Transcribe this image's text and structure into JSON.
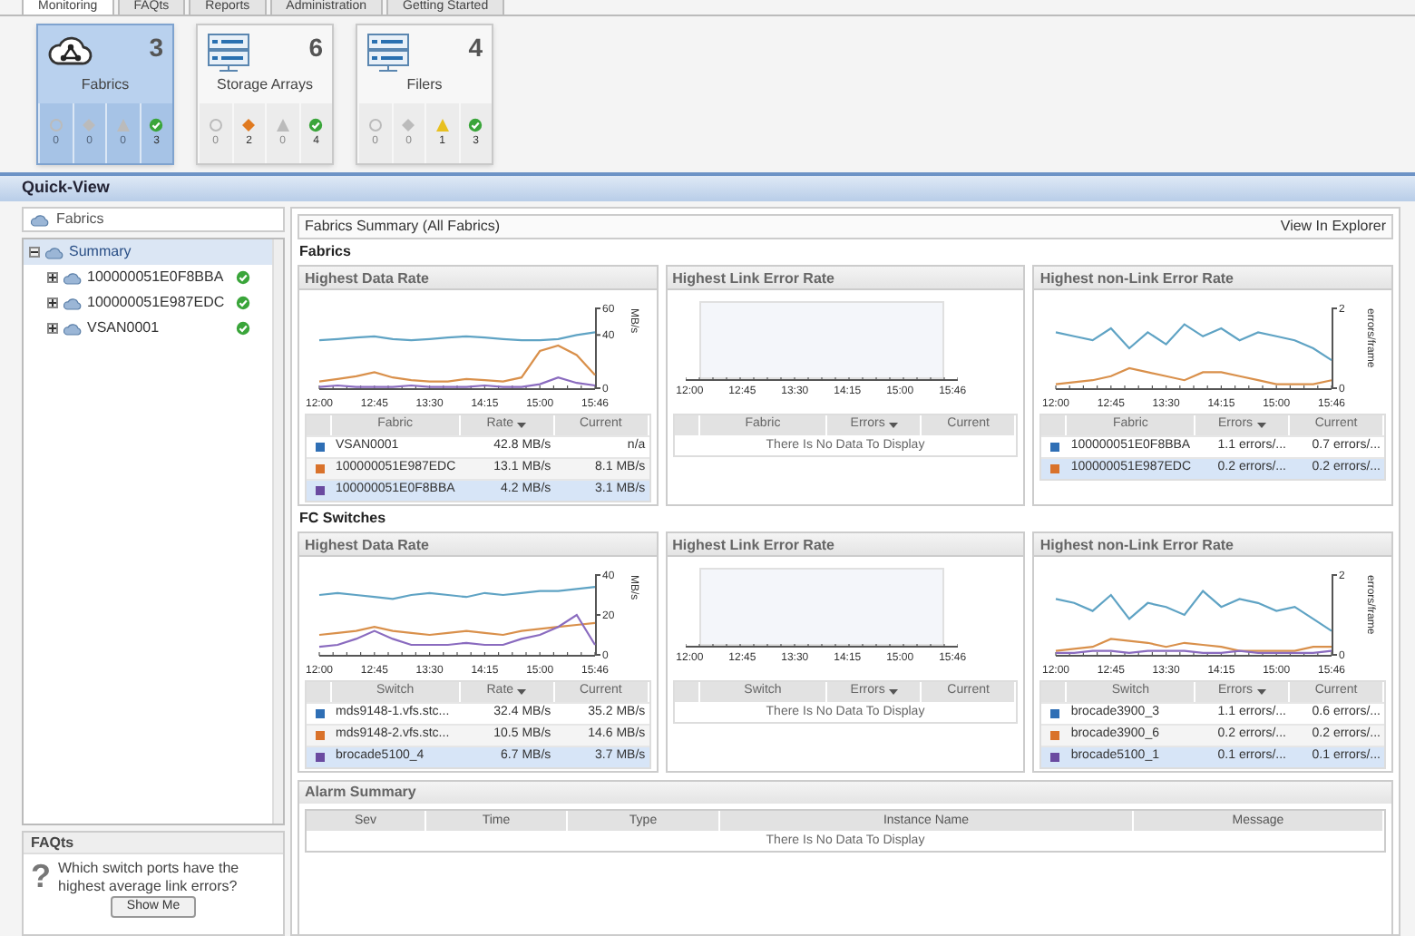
{
  "tabs": [
    {
      "label": "Monitoring",
      "selected": true
    },
    {
      "label": "FAQts",
      "selected": false
    },
    {
      "label": "Reports",
      "selected": false
    },
    {
      "label": "Administration",
      "selected": false
    },
    {
      "label": "Getting Started",
      "selected": false
    }
  ],
  "tiles": [
    {
      "label": "Fabrics",
      "count": "3",
      "selected": true,
      "statuses": [
        {
          "kind": "critical",
          "count": "0",
          "active": false
        },
        {
          "kind": "major",
          "count": "0",
          "active": false
        },
        {
          "kind": "warning",
          "count": "0",
          "active": false
        },
        {
          "kind": "ok",
          "count": "3",
          "active": true
        }
      ]
    },
    {
      "label": "Storage Arrays",
      "count": "6",
      "selected": false,
      "statuses": [
        {
          "kind": "critical",
          "count": "0",
          "active": false
        },
        {
          "kind": "major",
          "count": "2",
          "active": true
        },
        {
          "kind": "warning",
          "count": "0",
          "active": false
        },
        {
          "kind": "ok",
          "count": "4",
          "active": true
        }
      ]
    },
    {
      "label": "Filers",
      "count": "4",
      "selected": false,
      "statuses": [
        {
          "kind": "critical",
          "count": "0",
          "active": false
        },
        {
          "kind": "major",
          "count": "0",
          "active": false
        },
        {
          "kind": "warning",
          "count": "1",
          "active": true
        },
        {
          "kind": "ok",
          "count": "3",
          "active": true
        }
      ]
    }
  ],
  "quick_view": {
    "title": "Quick-View",
    "selector": "Fabrics",
    "tree": [
      {
        "label": "Summary",
        "expanded": true,
        "selected": true,
        "children": [
          {
            "label": "100000051E0F8BBA",
            "expanded": false,
            "selected": false,
            "healthy": true
          },
          {
            "label": "100000051E987EDC",
            "expanded": false,
            "selected": false,
            "healthy": true
          },
          {
            "label": "VSAN0001",
            "expanded": false,
            "selected": false,
            "healthy": true
          }
        ]
      }
    ],
    "faq": {
      "title": "FAQts",
      "mark": "?",
      "question": "Which switch ports have the highest average link errors?",
      "button": "Show Me"
    }
  },
  "summary": {
    "title": "Fabrics Summary (All Fabrics)",
    "link": "View In Explorer",
    "sections": [
      {
        "title": "Fabrics",
        "panels": [
          {
            "title": "Highest Data Rate",
            "kind": "data",
            "chart_data": {
              "type": "line",
              "categories": [
                "12:00",
                null,
                null,
                "12:45",
                null,
                null,
                "13:30",
                null,
                null,
                "14:15",
                null,
                null,
                "15:00",
                null,
                null,
                "15:46"
              ],
              "yticks": [
                0,
                40,
                60
              ],
              "ylim": [
                0,
                60
              ],
              "ylabel": "MB/s",
              "series": [
                {
                  "color": "#5fa3c4",
                  "values": [
                    36,
                    37,
                    38,
                    39,
                    37,
                    36,
                    37,
                    38,
                    39,
                    38,
                    37,
                    36,
                    36,
                    37,
                    40,
                    42
                  ]
                },
                {
                  "color": "#d9904b",
                  "values": [
                    5,
                    7,
                    9,
                    12,
                    8,
                    6,
                    5,
                    5,
                    7,
                    6,
                    5,
                    8,
                    28,
                    32,
                    25,
                    10
                  ]
                },
                {
                  "color": "#8a6bbf",
                  "values": [
                    1,
                    2,
                    1,
                    1,
                    1,
                    2,
                    1,
                    1,
                    1,
                    2,
                    1,
                    1,
                    3,
                    8,
                    4,
                    2
                  ]
                }
              ]
            },
            "columns": [
              {
                "label": "Fabric",
                "sorted": false
              },
              {
                "label": "Rate",
                "sorted": true
              },
              {
                "label": "Current",
                "sorted": false
              }
            ],
            "rows": [
              {
                "color": "#2f6fb5",
                "name": "VSAN0001",
                "rate": "42.8 MB/s",
                "current": "n/a",
                "selected": false
              },
              {
                "color": "#d9722b",
                "name": "100000051E987EDC",
                "rate": "13.1 MB/s",
                "current": "8.1 MB/s",
                "selected": false
              },
              {
                "color": "#6a4aa0",
                "name": "100000051E0F8BBA",
                "rate": "4.2 MB/s",
                "current": "3.1 MB/s",
                "selected": true
              }
            ]
          },
          {
            "title": "Highest Link Error Rate",
            "kind": "empty",
            "x_ticks": [
              "12:00",
              "12:45",
              "13:30",
              "14:15",
              "15:00",
              "15:46"
            ],
            "columns": [
              {
                "label": "Fabric",
                "sorted": false
              },
              {
                "label": "Errors",
                "sorted": true
              },
              {
                "label": "Current",
                "sorted": false
              }
            ],
            "empty_text": "There Is No Data To Display"
          },
          {
            "title": "Highest non-Link Error Rate",
            "kind": "data",
            "chart_data": {
              "type": "line",
              "categories": [
                "12:00",
                null,
                null,
                "12:45",
                null,
                null,
                "13:30",
                null,
                null,
                "14:15",
                null,
                null,
                "15:00",
                null,
                null,
                "15:46"
              ],
              "yticks": [
                0,
                2
              ],
              "ylim": [
                0,
                2
              ],
              "ylabel": "errors/frame",
              "series": [
                {
                  "color": "#5fa3c4",
                  "values": [
                    1.4,
                    1.3,
                    1.2,
                    1.5,
                    1.0,
                    1.4,
                    1.1,
                    1.6,
                    1.3,
                    1.5,
                    1.2,
                    1.4,
                    1.3,
                    1.2,
                    1.0,
                    0.7
                  ]
                },
                {
                  "color": "#d9904b",
                  "values": [
                    0.1,
                    0.15,
                    0.2,
                    0.3,
                    0.5,
                    0.4,
                    0.3,
                    0.2,
                    0.4,
                    0.4,
                    0.3,
                    0.2,
                    0.1,
                    0.1,
                    0.1,
                    0.2
                  ]
                }
              ]
            },
            "columns": [
              {
                "label": "Fabric",
                "sorted": false
              },
              {
                "label": "Errors",
                "sorted": true
              },
              {
                "label": "Current",
                "sorted": false
              }
            ],
            "rows": [
              {
                "color": "#2f6fb5",
                "name": "100000051E0F8BBA",
                "rate": "1.1 errors/...",
                "current": "0.7 errors/...",
                "selected": false
              },
              {
                "color": "#d9722b",
                "name": "100000051E987EDC",
                "rate": "0.2 errors/...",
                "current": "0.2 errors/...",
                "selected": true
              }
            ]
          }
        ]
      },
      {
        "title": "FC Switches",
        "panels": [
          {
            "title": "Highest Data Rate",
            "kind": "data",
            "chart_data": {
              "type": "line",
              "categories": [
                "12:00",
                null,
                null,
                "12:45",
                null,
                null,
                "13:30",
                null,
                null,
                "14:15",
                null,
                null,
                "15:00",
                null,
                null,
                "15:46"
              ],
              "yticks": [
                0,
                20,
                40
              ],
              "ylim": [
                0,
                40
              ],
              "ylabel": "MB/s",
              "series": [
                {
                  "color": "#5fa3c4",
                  "values": [
                    30,
                    31,
                    30,
                    29,
                    28,
                    30,
                    31,
                    30,
                    29,
                    31,
                    30,
                    31,
                    32,
                    32,
                    33,
                    34
                  ]
                },
                {
                  "color": "#d9904b",
                  "values": [
                    10,
                    11,
                    12,
                    14,
                    12,
                    11,
                    10,
                    11,
                    12,
                    11,
                    10,
                    12,
                    13,
                    14,
                    15,
                    16
                  ]
                },
                {
                  "color": "#8a6bbf",
                  "values": [
                    4,
                    5,
                    8,
                    12,
                    8,
                    5,
                    5,
                    5,
                    6,
                    5,
                    5,
                    8,
                    10,
                    14,
                    20,
                    5
                  ]
                }
              ]
            },
            "columns": [
              {
                "label": "Switch",
                "sorted": false
              },
              {
                "label": "Rate",
                "sorted": true
              },
              {
                "label": "Current",
                "sorted": false
              }
            ],
            "rows": [
              {
                "color": "#2f6fb5",
                "name": "mds9148-1.vfs.stc...",
                "rate": "32.4 MB/s",
                "current": "35.2 MB/s",
                "selected": false
              },
              {
                "color": "#d9722b",
                "name": "mds9148-2.vfs.stc...",
                "rate": "10.5 MB/s",
                "current": "14.6 MB/s",
                "selected": false
              },
              {
                "color": "#6a4aa0",
                "name": "brocade5100_4",
                "rate": "6.7 MB/s",
                "current": "3.7 MB/s",
                "selected": true
              }
            ]
          },
          {
            "title": "Highest Link Error Rate",
            "kind": "empty",
            "x_ticks": [
              "12:00",
              "12:45",
              "13:30",
              "14:15",
              "15:00",
              "15:46"
            ],
            "columns": [
              {
                "label": "Switch",
                "sorted": false
              },
              {
                "label": "Errors",
                "sorted": true
              },
              {
                "label": "Current",
                "sorted": false
              }
            ],
            "empty_text": "There Is No Data To Display"
          },
          {
            "title": "Highest non-Link Error Rate",
            "kind": "data",
            "chart_data": {
              "type": "line",
              "categories": [
                "12:00",
                null,
                null,
                "12:45",
                null,
                null,
                "13:30",
                null,
                null,
                "14:15",
                null,
                null,
                "15:00",
                null,
                null,
                "15:46"
              ],
              "yticks": [
                0,
                2
              ],
              "ylim": [
                0,
                2
              ],
              "ylabel": "errors/frame",
              "series": [
                {
                  "color": "#5fa3c4",
                  "values": [
                    1.4,
                    1.3,
                    1.1,
                    1.5,
                    0.9,
                    1.3,
                    1.2,
                    1.0,
                    1.6,
                    1.2,
                    1.4,
                    1.3,
                    1.1,
                    1.2,
                    0.9,
                    0.6
                  ]
                },
                {
                  "color": "#d9904b",
                  "values": [
                    0.1,
                    0.15,
                    0.2,
                    0.4,
                    0.35,
                    0.3,
                    0.2,
                    0.3,
                    0.25,
                    0.2,
                    0.1,
                    0.1,
                    0.1,
                    0.1,
                    0.2,
                    0.2
                  ]
                },
                {
                  "color": "#8a6bbf",
                  "values": [
                    0.05,
                    0.05,
                    0.1,
                    0.1,
                    0.05,
                    0.1,
                    0.1,
                    0.1,
                    0.05,
                    0.05,
                    0.1,
                    0.05,
                    0.05,
                    0.05,
                    0.05,
                    0.1
                  ]
                }
              ]
            },
            "columns": [
              {
                "label": "Switch",
                "sorted": false
              },
              {
                "label": "Errors",
                "sorted": true
              },
              {
                "label": "Current",
                "sorted": false
              }
            ],
            "rows": [
              {
                "color": "#2f6fb5",
                "name": "brocade3900_3",
                "rate": "1.1 errors/...",
                "current": "0.6 errors/...",
                "selected": false
              },
              {
                "color": "#d9722b",
                "name": "brocade3900_6",
                "rate": "0.2 errors/...",
                "current": "0.2 errors/...",
                "selected": false
              },
              {
                "color": "#6a4aa0",
                "name": "brocade5100_1",
                "rate": "0.1 errors/...",
                "current": "0.1 errors/...",
                "selected": true
              }
            ]
          }
        ]
      }
    ]
  },
  "alarms": {
    "title": "Alarm Summary",
    "columns": [
      "Sev",
      "Time",
      "Type",
      "Instance Name",
      "Message"
    ],
    "empty_text": "There Is No Data To Display"
  }
}
